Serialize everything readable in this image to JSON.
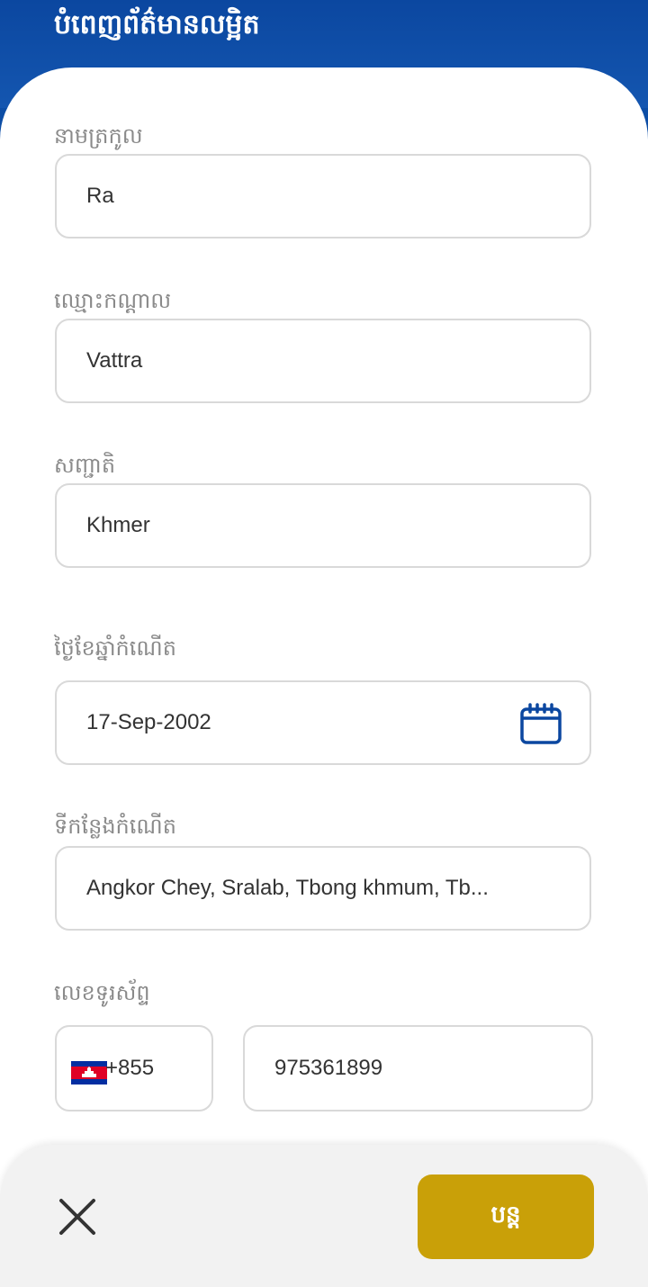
{
  "header": {
    "title": "បំពេញព័ត៌មានលម្អិត"
  },
  "form": {
    "last_name": {
      "label": "នាមត្រកូល",
      "value": "Ra"
    },
    "middle_name": {
      "label": "ឈ្មោះកណ្តាល",
      "value": "Vattra"
    },
    "nationality": {
      "label": "សញ្ជាតិ",
      "value": "Khmer"
    },
    "date_of_birth": {
      "label": "ថ្ងៃខែឆ្នាំកំណើត",
      "value": "17-Sep-2002",
      "icon": "calendar-icon"
    },
    "place_of_birth": {
      "label": "ទីកន្លែងកំណើត",
      "value": "Angkor Chey, Sralab, Tbong khmum, Tb..."
    },
    "phone": {
      "label": "លេខទូរស័ព្ទ",
      "country_code": "+855",
      "country_flag": "cambodia-flag-icon",
      "number": "975361899"
    }
  },
  "footer": {
    "close_icon": "close-icon",
    "continue_label": "បន្ត"
  },
  "colors": {
    "brand_blue": "#0b47a0",
    "accent_gold": "#c9a008",
    "field_border": "#d9d9d9",
    "label_gray": "#8a8a8a"
  }
}
